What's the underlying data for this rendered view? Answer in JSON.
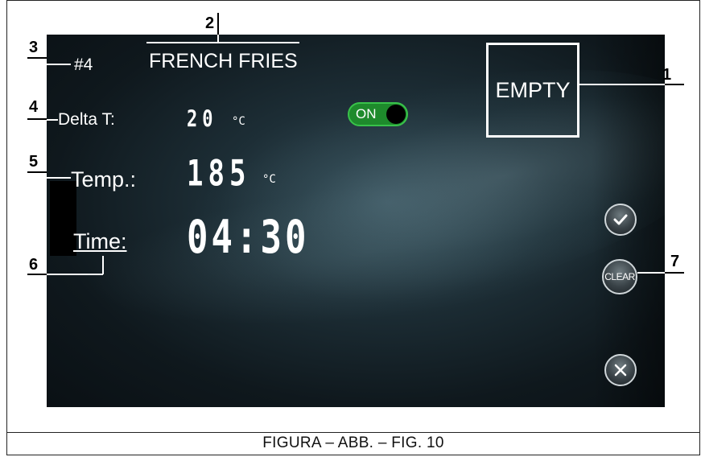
{
  "recipe": {
    "number": "#4",
    "name": "FRENCH FRIES",
    "status": "EMPTY"
  },
  "delta_t": {
    "label": "Delta T:",
    "value": "20",
    "unit": "°C",
    "toggle_label": "ON",
    "toggle_state": "on"
  },
  "temperature": {
    "label": "Temp.:",
    "value": "185",
    "unit": "°C"
  },
  "time": {
    "label": "Time:",
    "value": "04:30"
  },
  "buttons": {
    "confirm_icon": "check-icon",
    "clear_label": "CLEAR",
    "cancel_icon": "close-icon"
  },
  "callouts": {
    "c1": "1",
    "c2": "2",
    "c3": "3",
    "c4": "4",
    "c5": "5",
    "c6": "6",
    "c7": "7"
  },
  "caption": "FIGURA – ABB. – FIG. 10",
  "colors": {
    "toggle_on": "#1e8a2c",
    "text": "#ffffff"
  }
}
